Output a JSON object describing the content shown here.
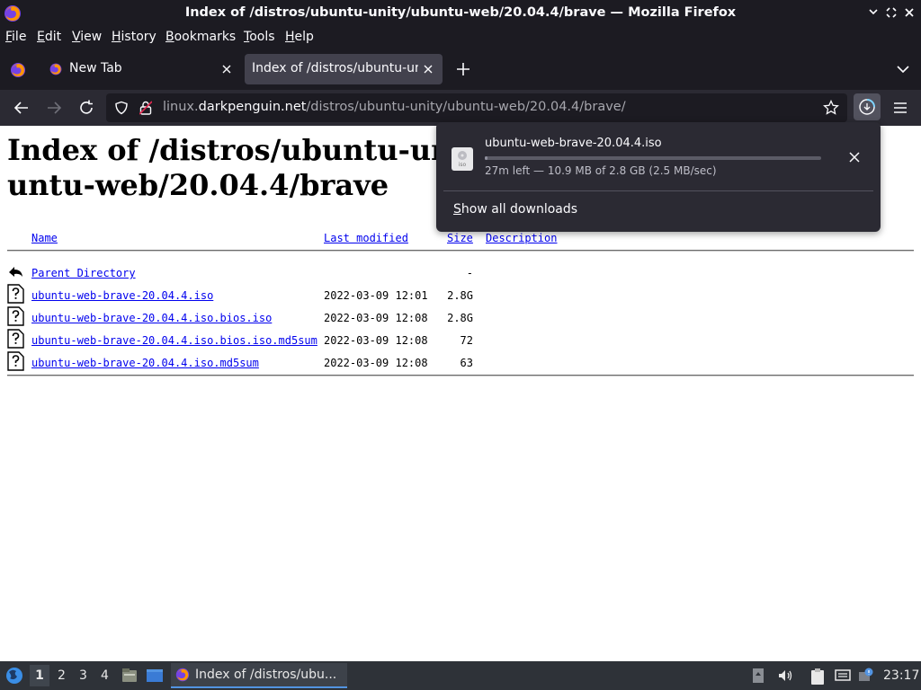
{
  "window": {
    "title": "Index of /distros/ubuntu-unity/ubuntu-web/20.04.4/brave — Mozilla Firefox"
  },
  "menubar": {
    "items": [
      {
        "label": "File"
      },
      {
        "label": "Edit"
      },
      {
        "label": "View"
      },
      {
        "label": "History"
      },
      {
        "label": "Bookmarks"
      },
      {
        "label": "Tools"
      },
      {
        "label": "Help"
      }
    ]
  },
  "tabs": [
    {
      "title": "New Tab",
      "active": false
    },
    {
      "title": "Index of /distros/ubuntu-unit",
      "active": true
    }
  ],
  "navbar": {
    "url_domain_prefix": "linux.",
    "url_domain": "darkpenguin.net",
    "url_path": "/distros/ubuntu-unity/ubuntu-web/20.04.4/brave/"
  },
  "page": {
    "heading": "Index of /distros/ubuntu-unity/ubuntu-web/20.04.4/brave",
    "columns": {
      "name": "Name",
      "last_modified": "Last modified",
      "size": "Size",
      "description": "Description"
    },
    "rows": [
      {
        "name": "Parent Directory",
        "date": "",
        "size": "-",
        "icon": "back-icon"
      },
      {
        "name": "ubuntu-web-brave-20.04.4.iso",
        "date": "2022-03-09 12:01",
        "size": "2.8G",
        "icon": "unknown-file-icon"
      },
      {
        "name": "ubuntu-web-brave-20.04.4.iso.bios.iso",
        "date": "2022-03-09 12:08",
        "size": "2.8G",
        "icon": "unknown-file-icon"
      },
      {
        "name": "ubuntu-web-brave-20.04.4.iso.bios.iso.md5sum",
        "date": "2022-03-09 12:08",
        "size": "72",
        "icon": "unknown-file-icon"
      },
      {
        "name": "ubuntu-web-brave-20.04.4.iso.md5sum",
        "date": "2022-03-09 12:08",
        "size": "63",
        "icon": "unknown-file-icon"
      }
    ]
  },
  "downloads_panel": {
    "filename": "ubuntu-web-brave-20.04.4.iso",
    "file_icon_label": "iso",
    "status": "27m left — 10.9 MB of 2.8 GB (2.5 MB/sec)",
    "progress_fraction": 0.004,
    "show_all_label": "Show all downloads"
  },
  "taskbar": {
    "workspaces": [
      "1",
      "2",
      "3",
      "4"
    ],
    "active_workspace": "1",
    "task_title": "Index of /distros/ubu...",
    "clock": "23:17"
  },
  "colors": {
    "chrome_dark": "#1c1b22",
    "toolbar": "#2b2a33",
    "link": "#0000ee",
    "taskbar": "#2e3238",
    "taskbar_accent": "#5294e2"
  }
}
